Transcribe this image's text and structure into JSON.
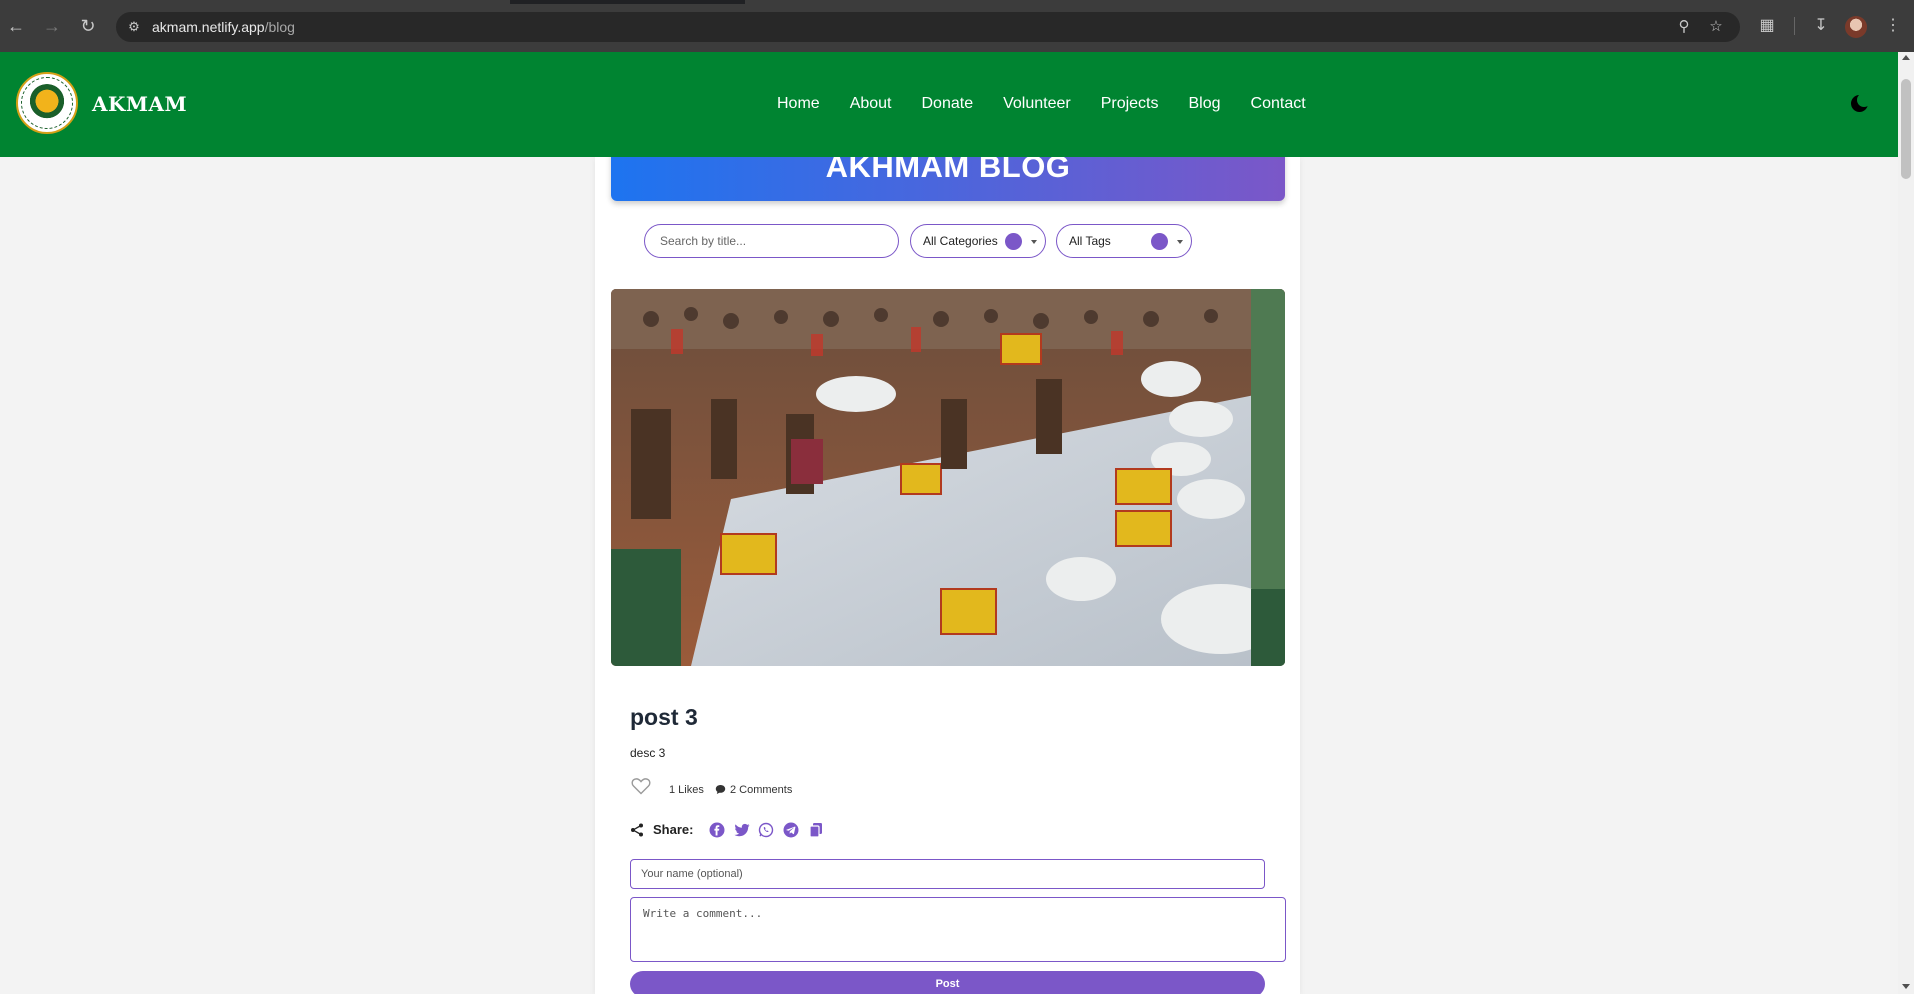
{
  "browser": {
    "url_host": "akmam.netlify.app",
    "url_path": "/blog"
  },
  "header": {
    "brand": "AKMAM",
    "nav": [
      "Home",
      "About",
      "Donate",
      "Volunteer",
      "Projects",
      "Blog",
      "Contact"
    ]
  },
  "blog": {
    "title": "AKHMAM BLOG",
    "search_placeholder": "Search by title...",
    "category_select": "All Categories",
    "tag_select": "All Tags"
  },
  "post": {
    "title": "post 3",
    "description": "desc 3",
    "likes": "1 Likes",
    "comments": "2 Comments",
    "share_label": "Share:",
    "name_placeholder": "Your name (optional)",
    "comment_placeholder": "Write a comment...",
    "post_button": "Post"
  },
  "colors": {
    "header_green": "#008431",
    "accent_purple": "#7b57c8",
    "banner_blue": "#1d74f0"
  }
}
